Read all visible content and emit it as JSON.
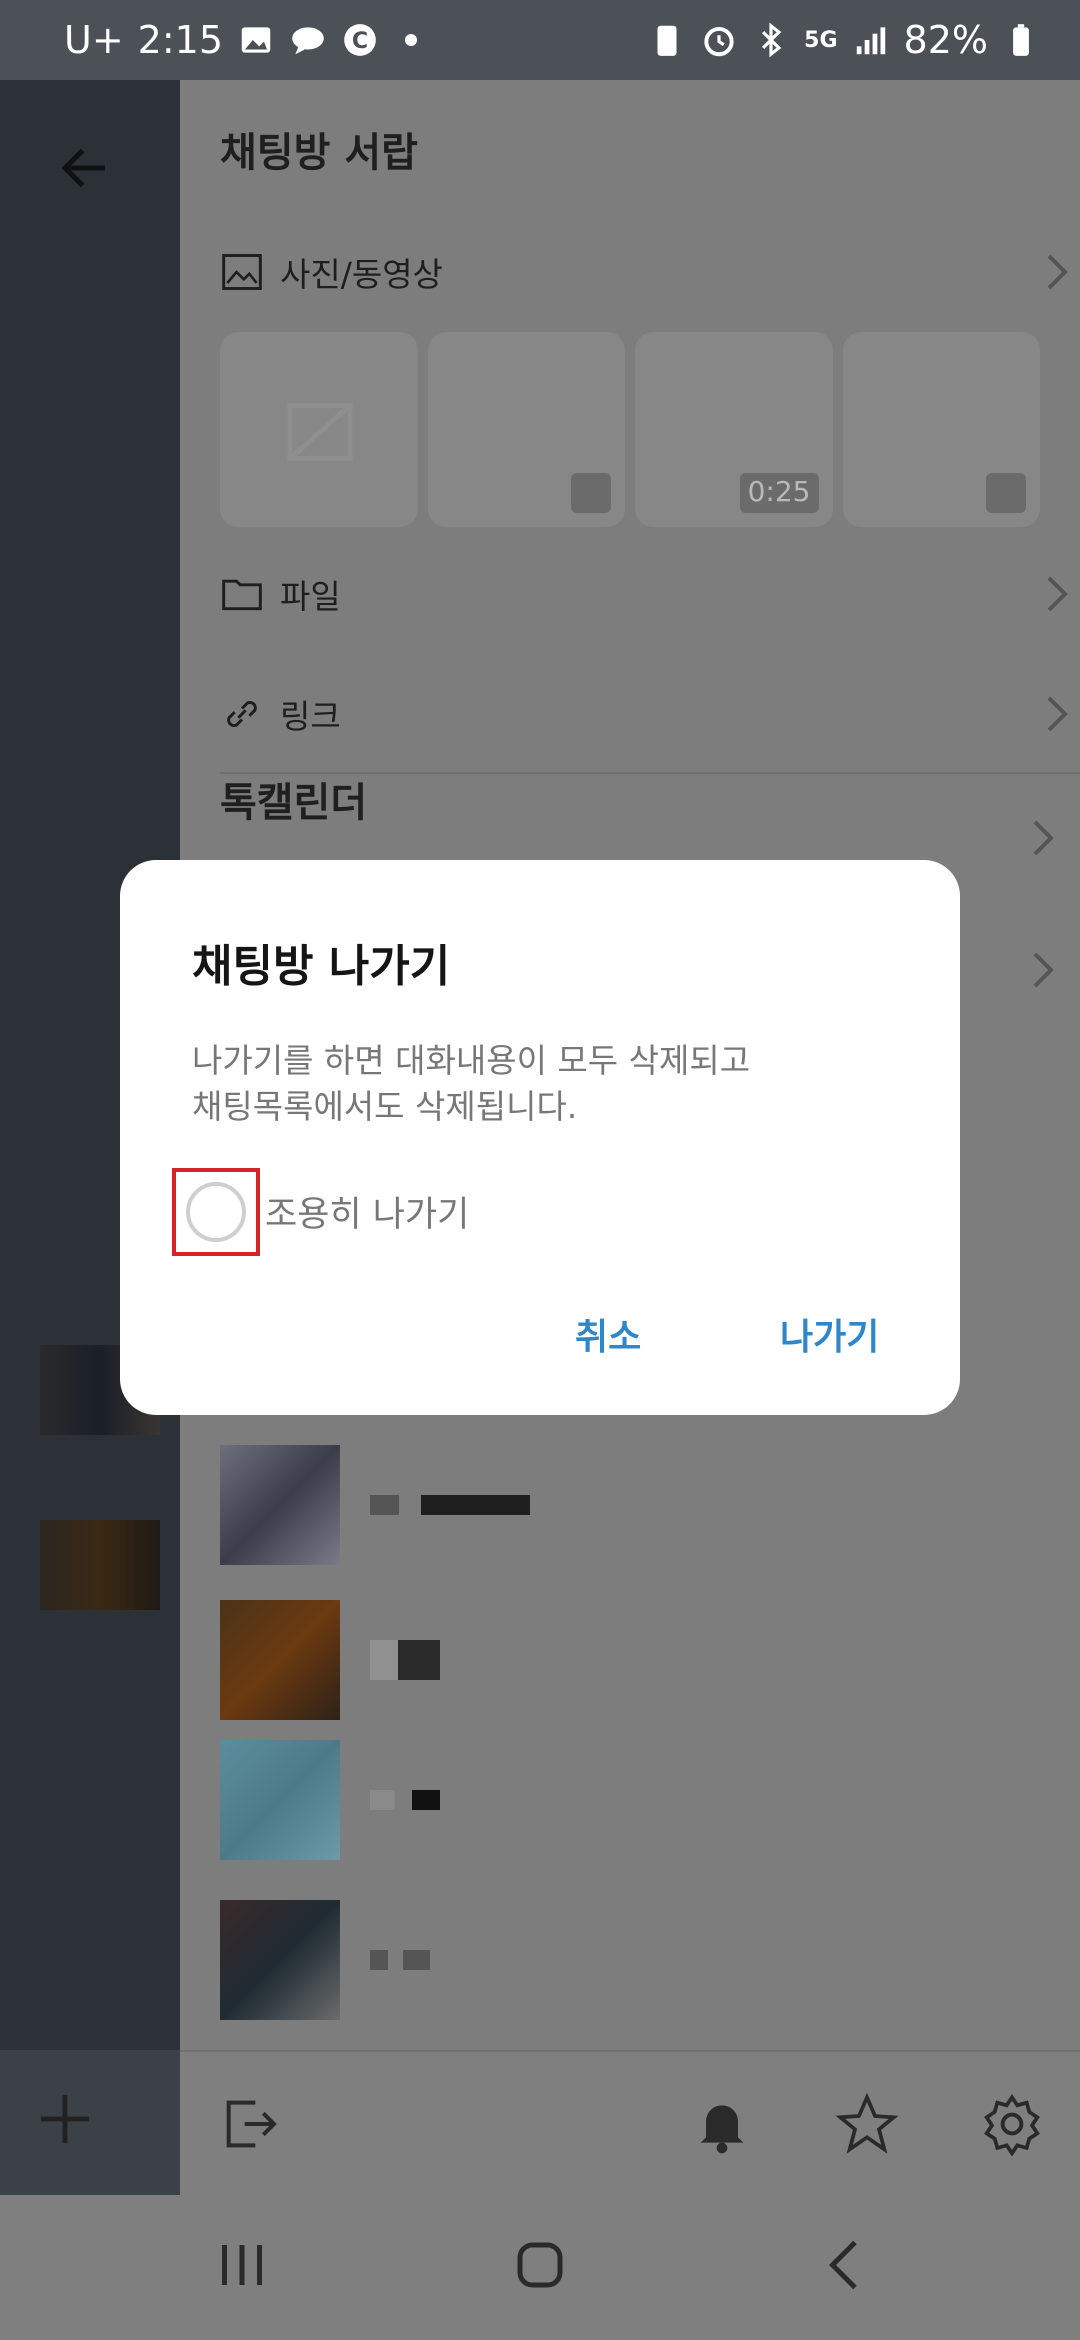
{
  "status_bar": {
    "carrier": "U+",
    "time": "2:15",
    "network": "5G",
    "battery": "82%"
  },
  "drawer": {
    "title": "채팅방 서랍",
    "media_label": "사진/동영상",
    "media_thumbs": [
      {
        "type": "image-placeholder",
        "badge": ""
      },
      {
        "type": "image",
        "badge": ""
      },
      {
        "type": "video",
        "badge": "0:25"
      },
      {
        "type": "image",
        "badge": ""
      }
    ],
    "file_label": "파일",
    "link_label": "링크",
    "calendar_title": "톡캘린더"
  },
  "dialog": {
    "title": "채팅방 나가기",
    "message": "나가기를 하면 대화내용이 모두 삭제되고\n채팅목록에서도 삭제됩니다.",
    "checkbox_label": "조용히 나가기",
    "checkbox_checked": false,
    "cancel_label": "취소",
    "leave_label": "나가기",
    "accent_color": "#2f86c8"
  },
  "highlight_color": "#d3242a"
}
